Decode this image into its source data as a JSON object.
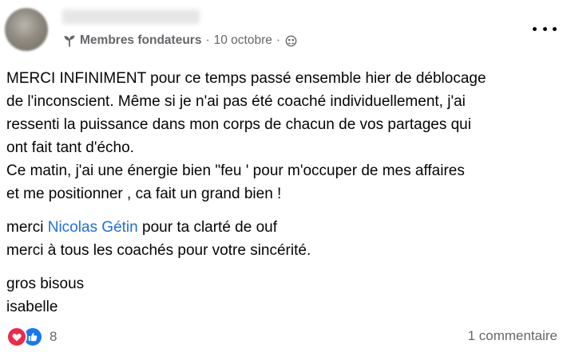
{
  "post": {
    "group_label": "Membres fondateurs",
    "separator": "·",
    "date": "10 octobre",
    "paragraphs": [
      [
        "MERCI INFINIMENT pour ce temps passé ensemble hier  de déblocage",
        "de l'inconscient.  Même si je n'ai pas été coaché individuellement, j'ai",
        "ressenti  la puissance dans mon corps de chacun de vos partages qui",
        "ont fait tant d'écho.",
        "Ce matin,  j'ai une énergie bien \"feu ' pour m'occuper de mes affaires",
        "et me positionner , ca fait un grand bien !"
      ]
    ],
    "mention_line": {
      "prefix": "merci ",
      "mention": "Nicolas Gétin",
      "suffix": " pour ta clarté de ouf"
    },
    "line_after_mention": "merci à tous les coachés pour votre sincérité.",
    "closing": [
      "gros bisous",
      "isabelle"
    ]
  },
  "footer": {
    "reaction_count": "8",
    "comments": "1 commentaire"
  },
  "icons": {
    "group": "group-sprout-icon",
    "audience": "group-audience-icon",
    "more": "more-options-icon",
    "love": "love-reaction-icon",
    "like": "like-reaction-icon"
  },
  "colors": {
    "text": "#050505",
    "secondary": "#65676b",
    "mention": "#216fdb",
    "love": "#f0284a",
    "like": "#1877f2"
  }
}
